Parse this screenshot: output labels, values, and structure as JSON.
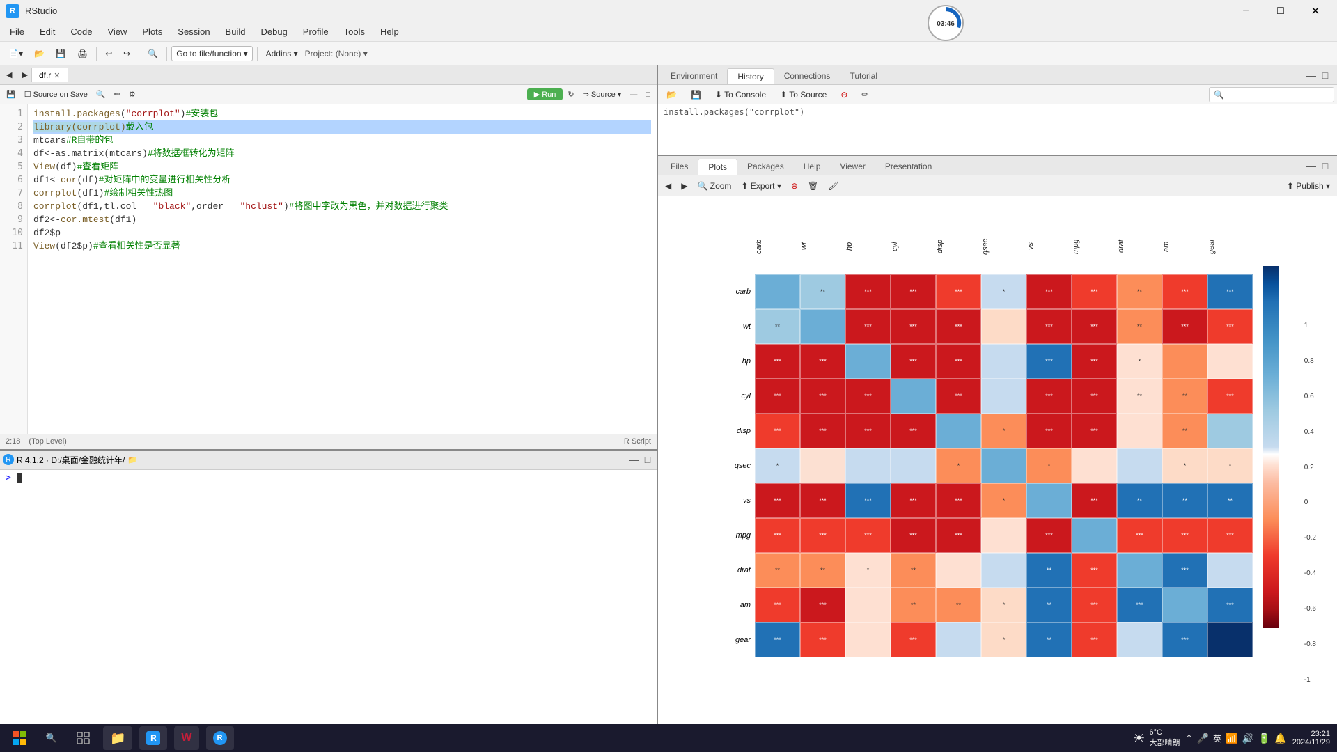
{
  "titlebar": {
    "title": "RStudio",
    "min": "−",
    "max": "□",
    "close": "✕"
  },
  "menubar": {
    "items": [
      "File",
      "Edit",
      "Code",
      "View",
      "Plots",
      "Session",
      "Build",
      "Debug",
      "Profile",
      "Tools",
      "Help"
    ]
  },
  "toolbar": {
    "new_file": "📄",
    "open": "📂",
    "save": "💾",
    "go_to_file": "Go to file/function",
    "addins": "Addins ▼"
  },
  "editor": {
    "tab": "df.r",
    "lines": [
      {
        "num": 1,
        "code": "install.packages(\"corrplot\")#安装包",
        "selected": false
      },
      {
        "num": 2,
        "code": "library(corrplot)载入包",
        "selected": true
      },
      {
        "num": 3,
        "code": "mtcars#R自带的包",
        "selected": false
      },
      {
        "num": 4,
        "code": "df<-as.matrix(mtcars)#将数据框转化为矩阵",
        "selected": false
      },
      {
        "num": 5,
        "code": "View(df)#查看矩阵",
        "selected": false
      },
      {
        "num": 6,
        "code": "df1<-cor(df)#对矩阵中的变量进行相关性分析",
        "selected": false
      },
      {
        "num": 7,
        "code": "corrplot(df1)#绘制相关性热图",
        "selected": false
      },
      {
        "num": 8,
        "code": "corrplot(df1,tl.col = \"black\",order = \"hclust\")#将图中字改为黑色，并对数据进行聚类",
        "selected": false
      },
      {
        "num": 9,
        "code": "df2<-cor.mtest(df1)",
        "selected": false
      },
      {
        "num": 10,
        "code": "df2$p",
        "selected": false
      },
      {
        "num": 11,
        "code": "View(df2$p)#查看相关性是否显著",
        "selected": false
      }
    ],
    "status": "2:18",
    "level": "(Top Level)",
    "lang": "R Script"
  },
  "console": {
    "path": "R 4.1.2 · D:/桌面/金融统计年/",
    "prompt": ">",
    "input": ""
  },
  "right_panel": {
    "top_tabs": [
      "Environment",
      "History",
      "Connections",
      "Tutorial"
    ],
    "active_top_tab": "History",
    "history_content": "install.packages(\"corrplot\")",
    "bottom_tabs": [
      "Files",
      "Plots",
      "Packages",
      "Help",
      "Viewer",
      "Presentation"
    ],
    "active_bottom_tab": "Plots"
  },
  "plots": {
    "labels": [
      "carb",
      "wt",
      "hp",
      "cyl",
      "disp",
      "qsec",
      "vs",
      "mpg",
      "drat",
      "am",
      "gear"
    ],
    "legend_values": [
      "1",
      "0.8",
      "0.6",
      "0.4",
      "0.2",
      "0",
      "-0.2",
      "-0.4",
      "-0.6",
      "-0.8",
      "-1"
    ],
    "cells": [
      [
        "diag",
        "light_blue2",
        "red3",
        "red3",
        "red3",
        "light_blue",
        "red3",
        "red3",
        "light_red",
        "red3",
        "blue2"
      ],
      [
        "light_blue2",
        "diag",
        "red3",
        "red3",
        "red3",
        "pink",
        "red3",
        "red3",
        "light_red",
        "red3",
        "red3"
      ],
      [
        "red3",
        "red3",
        "diag",
        "red3",
        "red3",
        "light_blue",
        "blue2",
        "red3",
        "light_red",
        "light_red",
        "light_red"
      ],
      [
        "red3",
        "red3",
        "red3",
        "diag",
        "red3",
        "light_blue",
        "red3",
        "red3",
        "light_red",
        "light_red",
        "red3"
      ],
      [
        "red3",
        "red3",
        "red3",
        "red3",
        "diag",
        "red2",
        "red3",
        "red3",
        "light_red",
        "light_red",
        "light_blue"
      ],
      [
        "light_blue",
        "pink",
        "light_blue",
        "light_blue",
        "red2",
        "diag",
        "red2",
        "light_red",
        "light_blue",
        "pink",
        "pink"
      ],
      [
        "red3",
        "red3",
        "blue2",
        "red3",
        "red3",
        "red2",
        "diag",
        "red3",
        "blue2",
        "blue2",
        "blue2"
      ],
      [
        "red3",
        "red3",
        "red3",
        "red3",
        "red3",
        "light_red",
        "red3",
        "diag",
        "red3",
        "red3",
        "red3"
      ],
      [
        "light_red",
        "light_red",
        "light_red",
        "light_red",
        "light_red",
        "light_blue",
        "blue2",
        "red3",
        "diag",
        "blue2",
        "light_blue"
      ],
      [
        "red3",
        "red3",
        "light_red",
        "light_red",
        "light_red",
        "pink",
        "blue2",
        "red3",
        "blue2",
        "diag",
        "blue2"
      ],
      [
        "blue2",
        "red3",
        "light_red",
        "red3",
        "light_blue",
        "pink",
        "blue2",
        "red3",
        "light_blue",
        "blue2",
        "diag"
      ]
    ],
    "cell_texts": [
      [
        "",
        "**",
        "***",
        "***",
        "***",
        "*",
        "***",
        "***",
        "**",
        "***",
        "***"
      ],
      [
        "**",
        "",
        "***",
        "***",
        "***",
        "",
        "***",
        "***",
        "**",
        "***",
        "***"
      ],
      [
        "***",
        "***",
        "",
        "***",
        "***",
        "",
        "***",
        "***",
        "*",
        "",
        ""
      ],
      [
        "***",
        "***",
        "***",
        "",
        "***",
        "",
        "***",
        "***",
        "**",
        "**",
        "***"
      ],
      [
        "***",
        "***",
        "***",
        "***",
        "",
        "*",
        "***",
        "***",
        "",
        "**",
        ""
      ],
      [
        "*",
        "",
        "",
        "",
        "*",
        "",
        "*",
        "",
        "",
        "*",
        "*"
      ],
      [
        "***",
        "***",
        "***",
        "***",
        "***",
        "*",
        "",
        "***",
        "**",
        "**",
        "**"
      ],
      [
        "***",
        "***",
        "***",
        "***",
        "***",
        "",
        "***",
        "",
        "***",
        "***",
        "***"
      ],
      [
        "**",
        "**",
        "*",
        "**",
        "",
        "",
        "**",
        "***",
        "",
        "***",
        ""
      ],
      [
        "***",
        "***",
        "",
        "**",
        "**",
        "*",
        "**",
        "***",
        "***",
        "",
        "***"
      ],
      [
        "***",
        "***",
        "",
        "***",
        "",
        "*",
        "**",
        "***",
        "",
        "***",
        ""
      ]
    ]
  },
  "taskbar": {
    "weather": "6°C",
    "weather_desc": "大部晴朗",
    "start_btn": "⊞",
    "search_btn": "🔍",
    "time": "23:21",
    "date": "2024/11/29",
    "lang": "英"
  },
  "clock": {
    "time": "03:46"
  }
}
